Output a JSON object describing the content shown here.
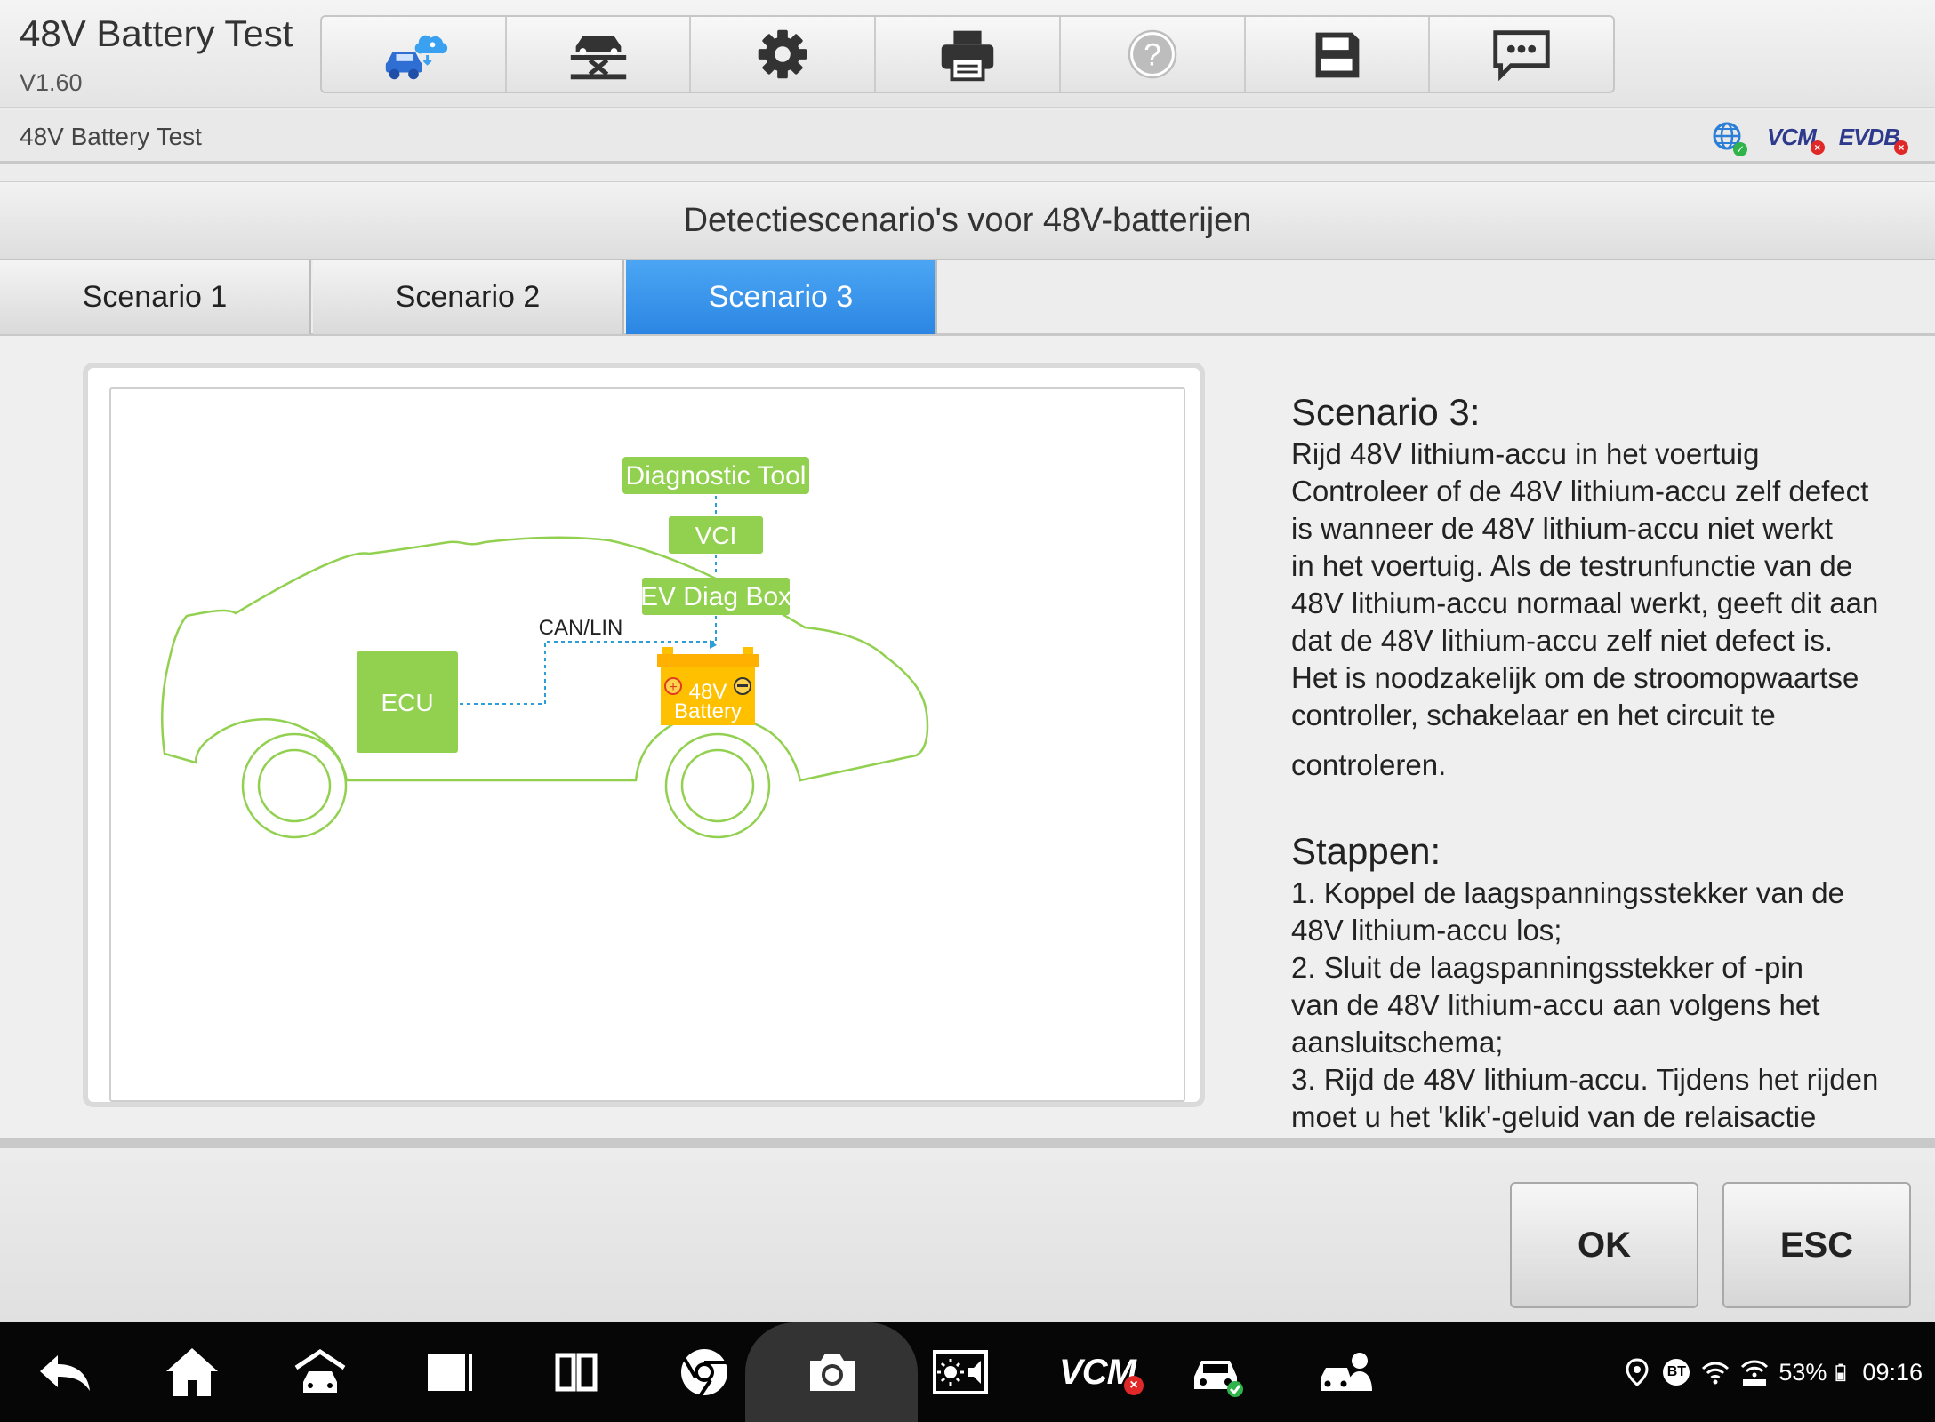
{
  "header": {
    "title": "48V Battery Test",
    "version": "V1.60",
    "toolbar": [
      {
        "name": "remote-expert-icon"
      },
      {
        "name": "car-lift-icon"
      },
      {
        "name": "settings-gear-icon"
      },
      {
        "name": "printer-icon"
      },
      {
        "name": "help-icon"
      },
      {
        "name": "save-icon"
      },
      {
        "name": "feedback-chat-icon"
      }
    ]
  },
  "subbar": {
    "breadcrumb": "48V Battery Test",
    "status": {
      "vcm": "VCM",
      "evdb": "EVDB"
    }
  },
  "page": {
    "title": "Detectiescenario's voor 48V-batterijen"
  },
  "tabs": [
    {
      "label": "Scenario 1",
      "active": false
    },
    {
      "label": "Scenario 2",
      "active": false
    },
    {
      "label": "Scenario 3",
      "active": true
    }
  ],
  "diagram": {
    "diagnostic_tool": "Diagnostic Tool",
    "vci": "VCI",
    "ev_diag_box": "EV Diag Box",
    "bus_label": "CAN/LIN",
    "ecu": "ECU",
    "battery_voltage": "48V",
    "battery_label": "Battery",
    "colors": {
      "green": "#92d050",
      "battery": "#ffc000",
      "line": "#2c9fd6"
    }
  },
  "description": {
    "heading": "Scenario 3:",
    "lines": [
      "Rijd 48V lithium-accu in het voertuig",
      "Controleer of de 48V lithium-accu zelf defect",
      "is wanneer de 48V lithium-accu niet werkt",
      "in het voertuig. Als de testrunfunctie van de",
      "48V lithium-accu normaal werkt, geeft dit aan",
      "dat de 48V lithium-accu zelf niet defect is.",
      "Het is noodzakelijk om de stroomopwaartse",
      "controller, schakelaar en het circuit te",
      "controleren."
    ],
    "steps_heading": "Stappen:",
    "steps": [
      "1. Koppel de laagspanningsstekker van de",
      "48V lithium-accu los;",
      "2. Sluit de laagspanningsstekker of -pin",
      "van de 48V lithium-accu aan volgens het",
      "aansluitschema;",
      "3. Rijd de 48V lithium-accu. Tijdens het rijden",
      "moet u het 'klik'-geluid van de relaisactie"
    ]
  },
  "footer": {
    "ok_label": "OK",
    "esc_label": "ESC"
  },
  "navbar": {
    "vcm": "VCM",
    "battery_percent": "53%",
    "time": "09:16",
    "bt": "BT",
    "colors": {
      "accent": "#2fb34a",
      "alert": "#e02828"
    }
  }
}
